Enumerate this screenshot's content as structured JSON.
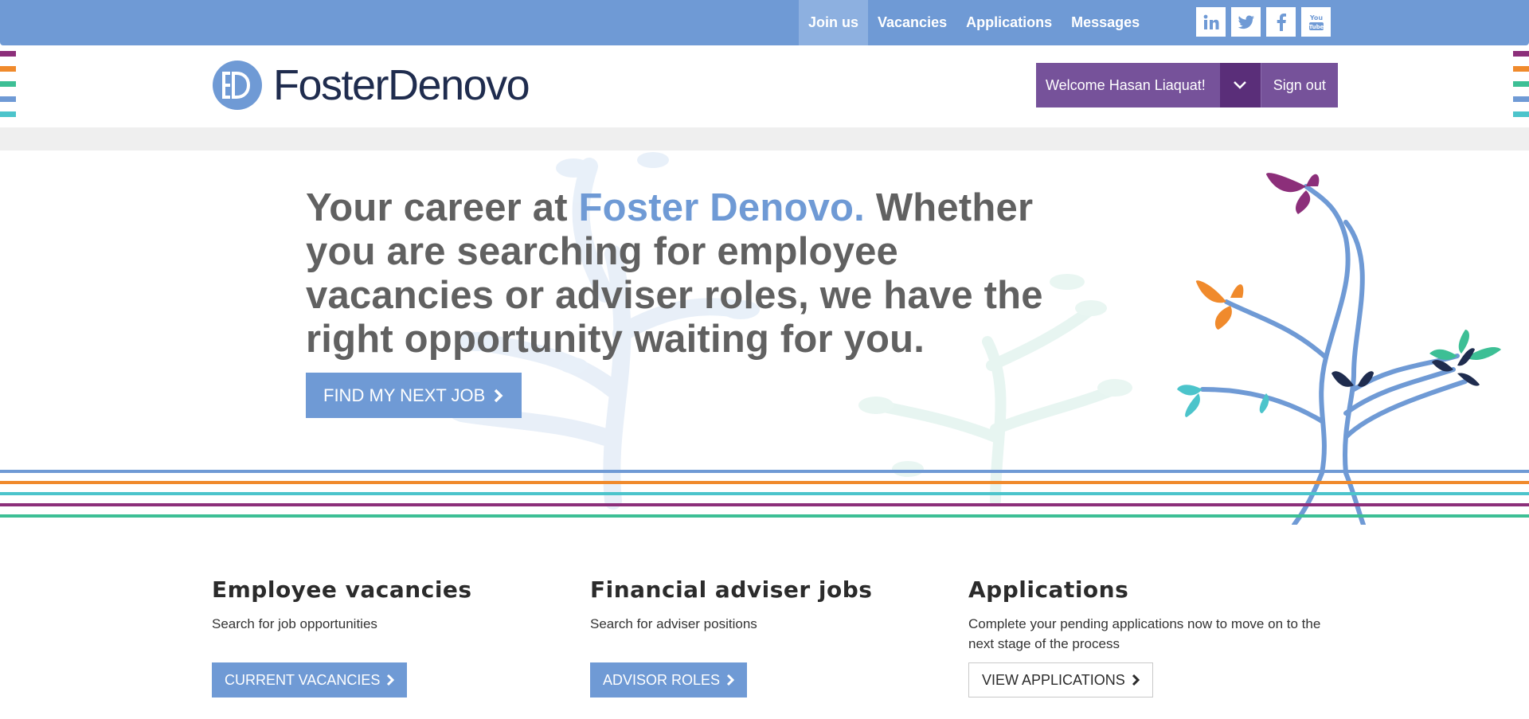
{
  "nav": {
    "items": [
      {
        "label": "Join us",
        "active": true
      },
      {
        "label": "Vacancies",
        "active": false
      },
      {
        "label": "Applications",
        "active": false
      },
      {
        "label": "Messages",
        "active": false
      }
    ],
    "socials": [
      "linkedin-icon",
      "twitter-icon",
      "facebook-icon",
      "youtube-icon"
    ],
    "youtube_text": "You Tube"
  },
  "brand": {
    "name": "FosterDenovo",
    "monogram": "FD",
    "color_blue": "#6f9ad5",
    "color_navy": "#1f2c4e",
    "color_purple": "#76529a"
  },
  "user": {
    "welcome": "Welcome Hasan Liaquat!",
    "signout": "Sign out"
  },
  "hero": {
    "headline_prefix": "Your career at ",
    "headline_brand": "Foster Denovo.",
    "headline_rest": " Whether you are searching for employee vacancies or adviser roles, we have the right opportunity waiting for you.",
    "cta": "FIND MY NEXT JOB"
  },
  "cards": [
    {
      "title": "Employee vacancies",
      "desc": "Search for job opportunities",
      "button": "CURRENT VACANCIES"
    },
    {
      "title": "Financial adviser jobs",
      "desc": "Search for adviser positions",
      "button": "ADVISOR ROLES"
    },
    {
      "title": "Applications",
      "desc": "Complete your pending applications now to move on to the next stage of the process",
      "button": "VIEW APPLICATIONS"
    }
  ],
  "stripe_colors": [
    "#8c2f7a",
    "#f08a2c",
    "#3dbf95",
    "#6f9ad5",
    "#4cc4cb"
  ]
}
